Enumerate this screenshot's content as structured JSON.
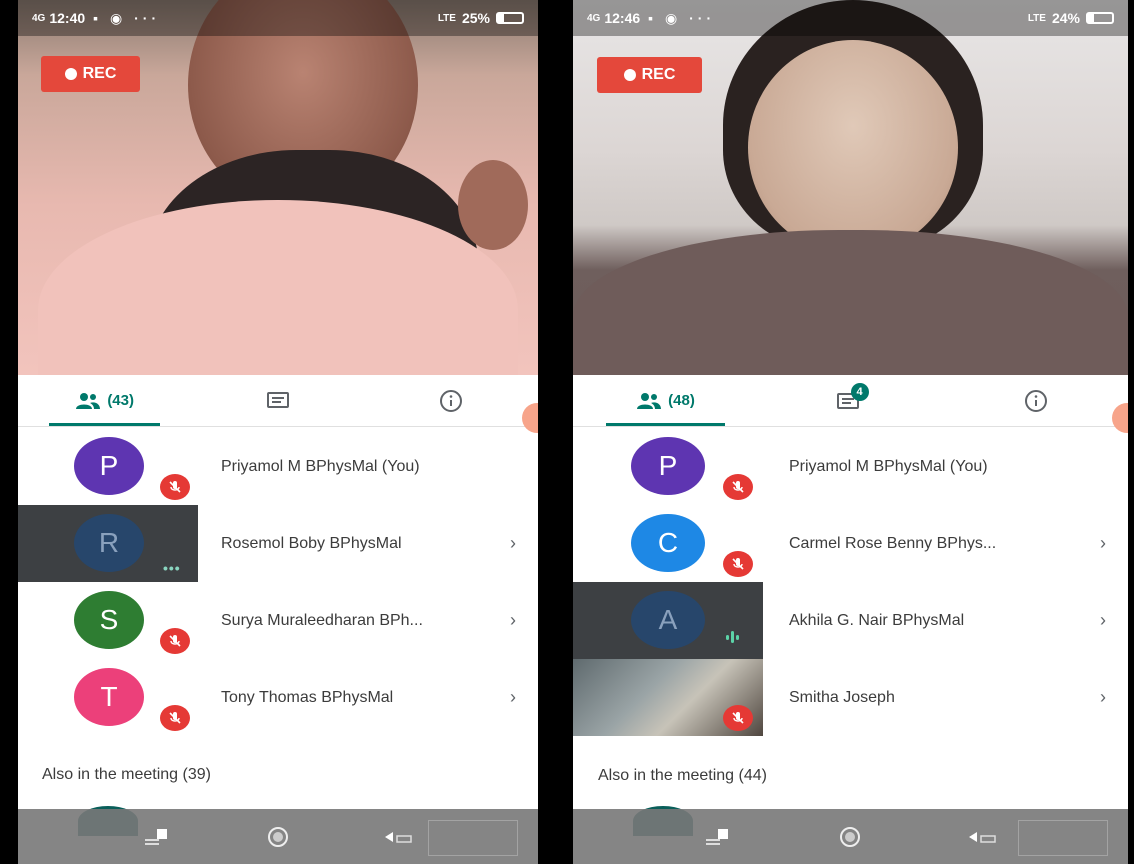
{
  "left_screen": {
    "status": {
      "time": "12:40",
      "signal": "4G",
      "network": "LTE",
      "battery": "25%",
      "battery_level": 0.25
    },
    "rec_label": "REC",
    "tabs": {
      "people_count": "(43)"
    },
    "participants": [
      {
        "initial": "P",
        "name": "Priyamol M BPhysMal (You)",
        "color": "#5e35b1",
        "tile": "light",
        "indicator": "muted",
        "chevron": false
      },
      {
        "initial": "R",
        "name": "Rosemol Boby BPhysMal",
        "color": "#27466b",
        "tile": "dark",
        "indicator": "more",
        "chevron": true
      },
      {
        "initial": "S",
        "name": "Surya Muraleedharan BPh...",
        "color": "#2e7d32",
        "tile": "light",
        "indicator": "muted",
        "chevron": true
      },
      {
        "initial": "T",
        "name": "Tony Thomas BPhysMal",
        "color": "#ec407a",
        "tile": "light",
        "indicator": "muted",
        "chevron": true
      }
    ],
    "also_label": "Also in the meeting (39)",
    "more_dots": "•••"
  },
  "right_screen": {
    "status": {
      "time": "12:46",
      "signal": "4G",
      "network": "LTE",
      "battery": "24%",
      "battery_level": 0.24
    },
    "rec_label": "REC",
    "tabs": {
      "people_count": "(48)",
      "chat_badge": "4"
    },
    "participants": [
      {
        "initial": "P",
        "name": "Priyamol M BPhysMal (You)",
        "color": "#5e35b1",
        "tile": "light",
        "indicator": "muted",
        "chevron": false
      },
      {
        "initial": "C",
        "name": "Carmel Rose Benny BPhys...",
        "color": "#1e88e5",
        "tile": "light",
        "indicator": "muted",
        "chevron": true
      },
      {
        "initial": "A",
        "name": "Akhila G. Nair BPhysMal",
        "color": "#27466b",
        "tile": "dark",
        "indicator": "speaking",
        "chevron": true
      },
      {
        "initial": "",
        "name": "Smitha Joseph",
        "color": "",
        "tile": "photo",
        "indicator": "muted",
        "chevron": true
      }
    ],
    "also_label": "Also in the meeting (44)"
  },
  "chevron_glyph": "›",
  "icons": {
    "people_tab": "people-icon",
    "chat_tab": "chat-icon",
    "info_tab": "info-icon",
    "mute": "mic-off-icon",
    "nav": [
      "menu-icon",
      "home-icon",
      "back-icon"
    ]
  },
  "colors": {
    "accent": "#00796b",
    "rec": "#e4483b",
    "mute": "#e53935"
  }
}
